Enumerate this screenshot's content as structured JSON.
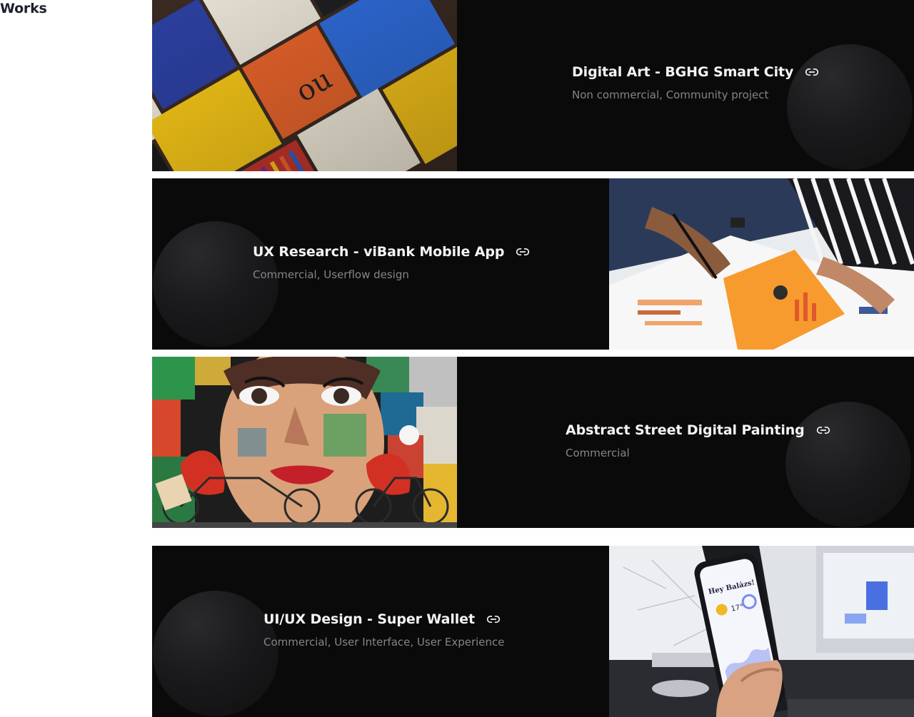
{
  "section": {
    "title": "Works"
  },
  "works": [
    {
      "title": "Digital Art - BGHG Smart City",
      "tags": "Non commercial, Community project",
      "image": "collage of torn colorful posters and skateboards",
      "link_icon": "link-icon"
    },
    {
      "title": "UX Research - viBank Mobile App",
      "tags": "Commercial, Userflow design",
      "image": "hands sketching on printed infographic sheets",
      "link_icon": "link-icon"
    },
    {
      "title": "Abstract Street Digital Painting",
      "tags": "Commercial",
      "image": "street mural of a woman's face with bicycles",
      "link_icon": "link-icon"
    },
    {
      "title": "UI/UX Design - Super Wallet",
      "tags": "Commercial, User Interface, User Experience",
      "image": "hand holding phone with weather app in front of laptop",
      "link_icon": "link-icon"
    }
  ],
  "colors": {
    "card_bg": "#0a0a0b",
    "title": "#f4f4f5",
    "tags": "#85858a",
    "heading": "#1c1f2b"
  }
}
